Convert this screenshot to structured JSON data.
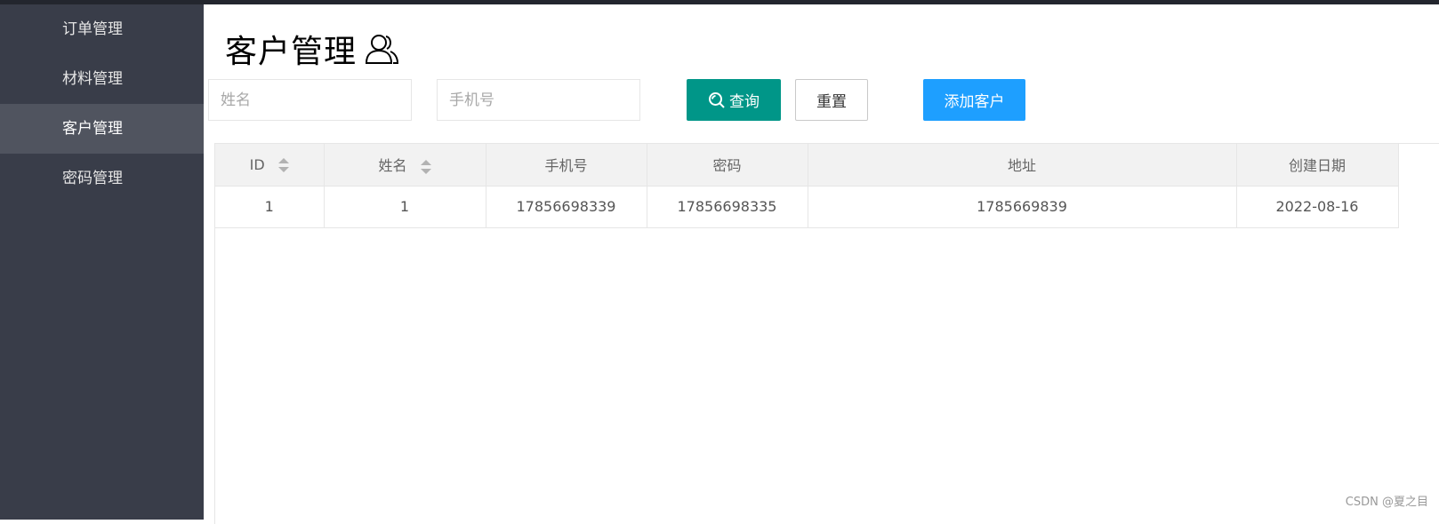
{
  "sidebar": {
    "items": [
      {
        "label": "订单管理"
      },
      {
        "label": "材料管理"
      },
      {
        "label": "客户管理"
      },
      {
        "label": "密码管理"
      }
    ]
  },
  "page": {
    "title": "客户管理",
    "title_icon": "user-group-icon"
  },
  "search": {
    "name_placeholder": "姓名",
    "phone_placeholder": "手机号",
    "query_label": "查询",
    "reset_label": "重置",
    "add_label": "添加客户"
  },
  "table": {
    "columns": [
      "ID",
      "姓名",
      "手机号",
      "密码",
      "地址",
      "创建日期"
    ],
    "rows": [
      [
        "1",
        "1",
        "17856698339",
        "17856698335",
        "1785669839",
        "2022-08-16"
      ]
    ]
  },
  "watermark": "CSDN @夏之目",
  "colors": {
    "sidebar_bg": "#393d49",
    "sidebar_active": "#50545f",
    "query_btn": "#009688",
    "add_btn": "#1e9fff"
  }
}
